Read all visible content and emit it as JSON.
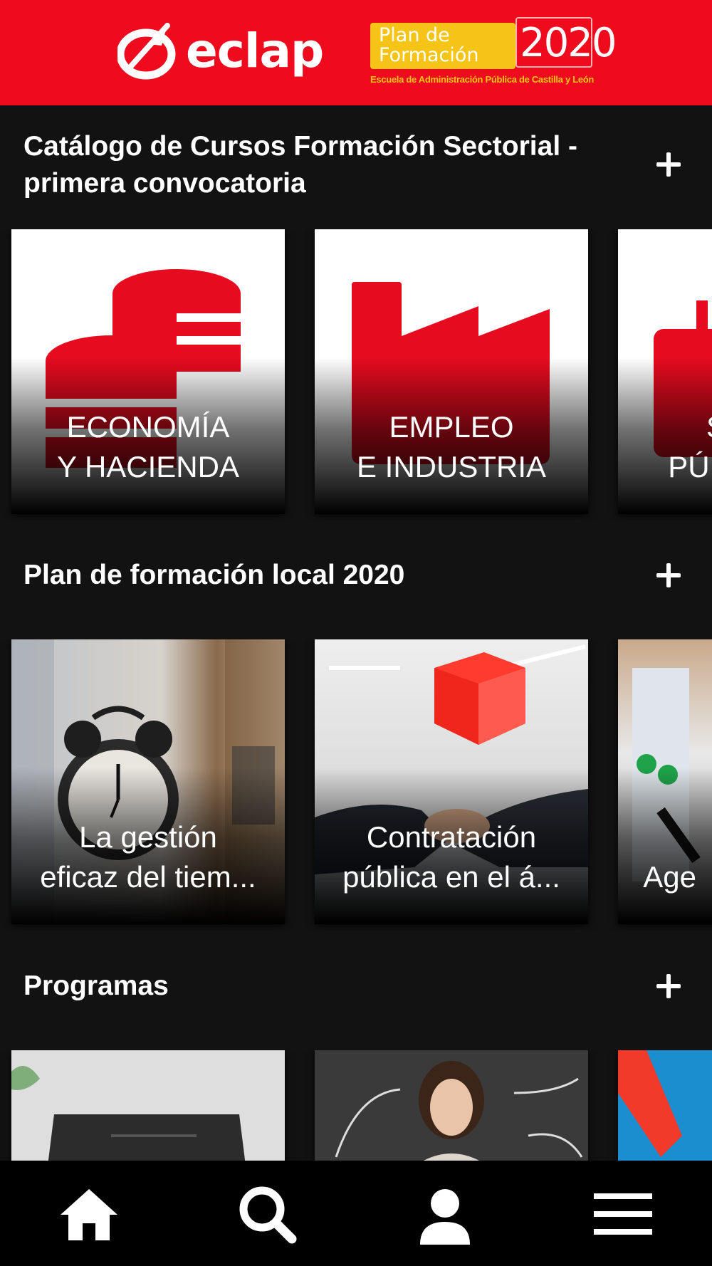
{
  "header": {
    "logo_text": "eclap",
    "plan_line1": "Plan de",
    "plan_line2": "Formación",
    "plan_year": "2020",
    "plan_subtitle": "Escuela de Administración Pública de Castilla y León"
  },
  "sections": [
    {
      "title_line1": "Catálogo de Cursos Formación Sectorial -",
      "title_line2": "primera convocatoria",
      "cards": [
        {
          "label_line1": "ECONOMÍA",
          "label_line2": "Y HACIENDA",
          "icon": "coins-icon"
        },
        {
          "label_line1": "EMPLEO",
          "label_line2": "E INDUSTRIA",
          "icon": "factory-icon"
        },
        {
          "label_line1": "SE",
          "label_line2": "PÚBL",
          "icon": "briefcase-icon"
        }
      ]
    },
    {
      "title": "Plan de formación local 2020",
      "cards": [
        {
          "label_line1": "La gestión",
          "label_line2": "eficaz del tiem...",
          "image": "alarm-clock-photo"
        },
        {
          "label_line1": "Contratación",
          "label_line2": "pública en el á...",
          "image": "handshake-photo"
        },
        {
          "label_line1": "Age",
          "label_line2": "",
          "image": "planner-photo"
        }
      ]
    },
    {
      "title": "Programas",
      "cards": [
        {
          "image": "laptop-photo"
        },
        {
          "image": "woman-arrows-photo"
        },
        {
          "image": "red-paper-photo"
        }
      ]
    }
  ],
  "tabbar": {
    "items": [
      "home-icon",
      "search-icon",
      "profile-icon",
      "menu-icon"
    ]
  },
  "colors": {
    "brand_red": "#f00a1e",
    "accent_yellow": "#f6c417",
    "background": "#121212",
    "icon_red": "#e60b1f"
  }
}
